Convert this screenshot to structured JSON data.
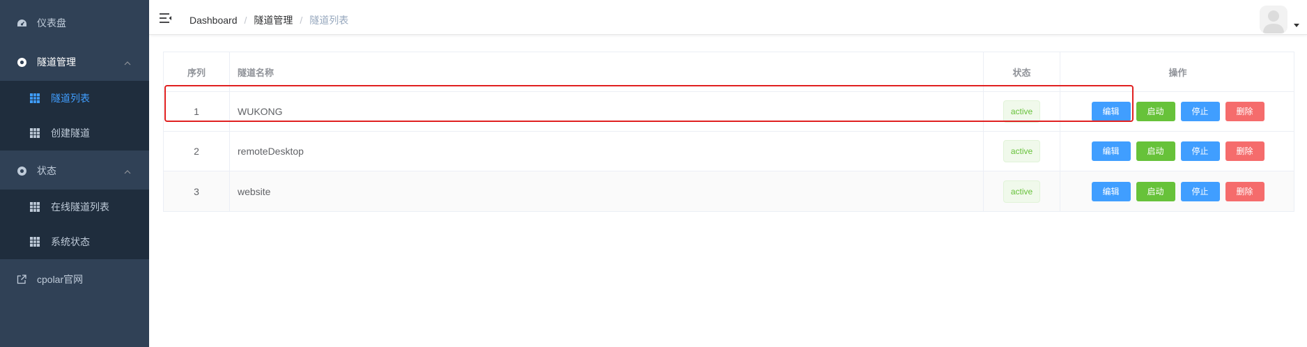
{
  "sidebar": {
    "items": [
      {
        "label": "仪表盘",
        "icon": "dashboard-icon"
      },
      {
        "label": "隧道管理",
        "icon": "tunnel-icon",
        "children": [
          {
            "label": "隧道列表",
            "active": true
          },
          {
            "label": "创建隧道"
          }
        ]
      },
      {
        "label": "状态",
        "icon": "status-icon",
        "children": [
          {
            "label": "在线隧道列表"
          },
          {
            "label": "系统状态"
          }
        ]
      },
      {
        "label": "cpolar官网",
        "icon": "external-link-icon"
      }
    ]
  },
  "breadcrumb": {
    "items": [
      "Dashboard",
      "隧道管理",
      "隧道列表"
    ],
    "separator": "/"
  },
  "table": {
    "columns": [
      "序列",
      "隧道名称",
      "状态",
      "操作"
    ],
    "rows": [
      {
        "index": "1",
        "name": "WUKONG",
        "status": "active"
      },
      {
        "index": "2",
        "name": "remoteDesktop",
        "status": "active"
      },
      {
        "index": "3",
        "name": "website",
        "status": "active"
      }
    ],
    "actions": {
      "edit": "编辑",
      "start": "启动",
      "stop": "停止",
      "delete": "删除"
    }
  },
  "colors": {
    "sidebar_bg": "#304156",
    "submenu_bg": "#1f2d3d",
    "active": "#409eff",
    "success": "#67c23a",
    "danger": "#f56c6c",
    "highlight_box": "#e02020"
  }
}
